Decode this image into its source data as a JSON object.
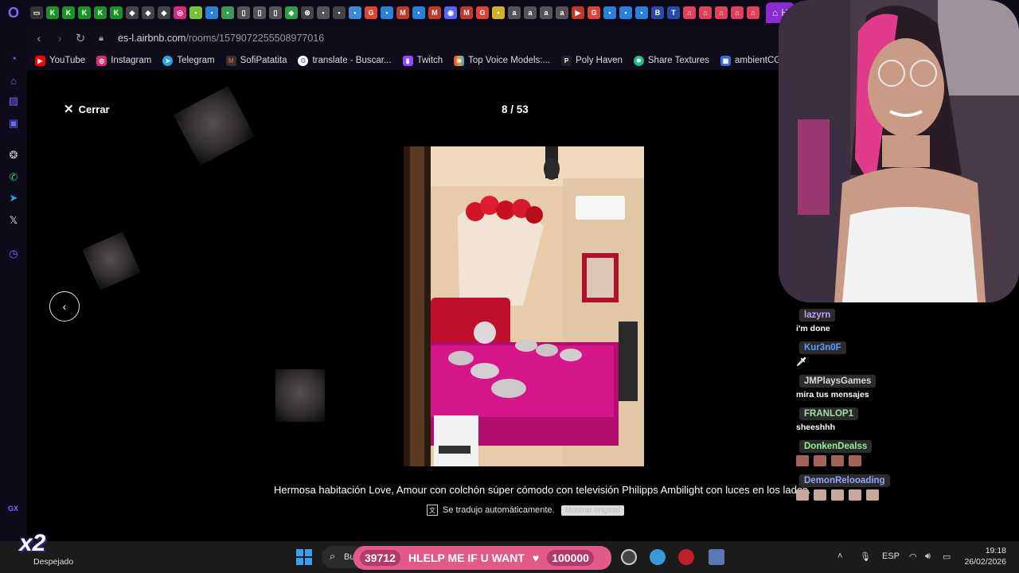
{
  "browser": {
    "url_host": "es-l.airbnb.com",
    "url_path": "/rooms/1579072255508977016",
    "active_tab_label": "H",
    "bookmarks": [
      {
        "label": "YouTube",
        "icon": "youtube-icon",
        "color": "#ff0000"
      },
      {
        "label": "Instagram",
        "icon": "instagram-icon",
        "color": "#d62976"
      },
      {
        "label": "Telegram",
        "icon": "telegram-icon",
        "color": "#2aa3e0"
      },
      {
        "label": "SofiPatatita",
        "icon": "gmail-icon",
        "color": "#c0392b"
      },
      {
        "label": "translate - Buscar...",
        "icon": "google-icon",
        "color": "#4285f4"
      },
      {
        "label": "Twitch",
        "icon": "twitch-icon",
        "color": "#9146ff"
      },
      {
        "label": "Top Voice Models:...",
        "icon": "voice-icon",
        "color": "#e0a030"
      },
      {
        "label": "Poly Haven",
        "icon": "polyhaven-icon",
        "color": "#ffffff"
      },
      {
        "label": "Share Textures",
        "icon": "sharetextures-icon",
        "color": "#1fb98a"
      },
      {
        "label": "ambientCG",
        "icon": "ambientcg-icon",
        "color": "#3a6bd6"
      }
    ]
  },
  "gallery": {
    "close_label": "Cerrar",
    "counter": "8 / 53",
    "caption": "Hermosa habitación Love, Amour con colchón súper cómodo con televisión Philipps Ambilight con luces en los lados.",
    "auto_translated": "Se tradujo automáticamente.",
    "show_original": "Mostrar original"
  },
  "chat": {
    "messages": [
      {
        "user": "lazyrn",
        "color": "#c89cff",
        "text": "i'm done"
      },
      {
        "user": "Kur3n0F",
        "color": "#5a9cff",
        "text": "🗡"
      },
      {
        "user": "JMPlaysGames",
        "color": "#d8d8d8",
        "text": "mira tus mensajes"
      },
      {
        "user": "FRANLOP1",
        "color": "#9fe09f",
        "text": "sheeshhh"
      },
      {
        "user": "DonkenDealss",
        "color": "#8ff08f",
        "text": "",
        "emotes": 4
      },
      {
        "user": "DemonRelooading",
        "color": "#8fa8ff",
        "text": "",
        "emotes": 5
      }
    ]
  },
  "stream_banner": {
    "left_number": "39712",
    "text": "HLELP ME IF U WANT",
    "right_number": "100000"
  },
  "taskbar": {
    "weather": "Despejado",
    "search_placeholder": "Bu",
    "overlay_badge": "x2",
    "gx_label": "GX",
    "language": "ESP",
    "time": "19:18",
    "date": "26/02/2026"
  }
}
